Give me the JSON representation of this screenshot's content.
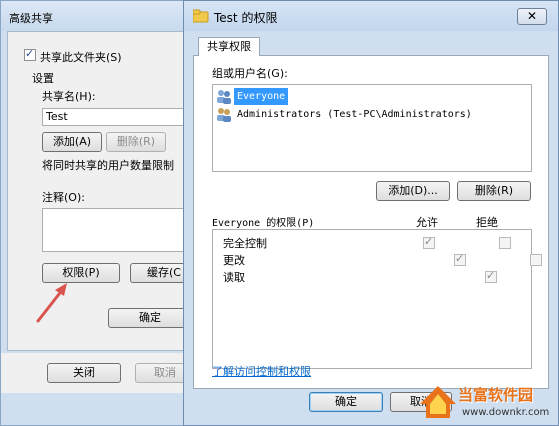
{
  "advanced": {
    "title": "高级共享",
    "share_checkbox": "共享此文件夹(S)",
    "settings_label": "设置",
    "share_name_label": "共享名(H):",
    "share_name_value": "Test",
    "add_btn": "添加(A)",
    "delete_btn": "删除(R)",
    "limit_text": "将同时共享的用户数量限制",
    "comment_label": "注释(O):",
    "permissions_btn": "权限(P)",
    "cache_btn": "缓存(C",
    "ok_btn": "确定",
    "close_btn": "关闭",
    "cancel_btn": "取消"
  },
  "perm": {
    "title": "Test 的权限",
    "tab": "共享权限",
    "group_label": "组或用户名(G):",
    "users": [
      {
        "name": "Everyone",
        "selected": true
      },
      {
        "name": "Administrators (Test-PC\\Administrators)",
        "selected": false
      }
    ],
    "add_btn": "添加(D)...",
    "remove_btn": "删除(R)",
    "perm_header": "Everyone 的权限(P)",
    "allow_header": "允许",
    "deny_header": "拒绝",
    "rows": [
      {
        "name": "完全控制",
        "allow": true,
        "deny": false
      },
      {
        "name": "更改",
        "allow": true,
        "deny": false
      },
      {
        "name": "读取",
        "allow": true,
        "deny": false
      }
    ],
    "link": "了解访问控制和权限",
    "ok_btn": "确定",
    "cancel_btn": "取消"
  },
  "watermark": {
    "name": "当富软件园",
    "url": "www.downkr.com"
  },
  "colors": {
    "selection": "#3399ff",
    "link": "#0066cc",
    "arrow": "#d9534f"
  }
}
